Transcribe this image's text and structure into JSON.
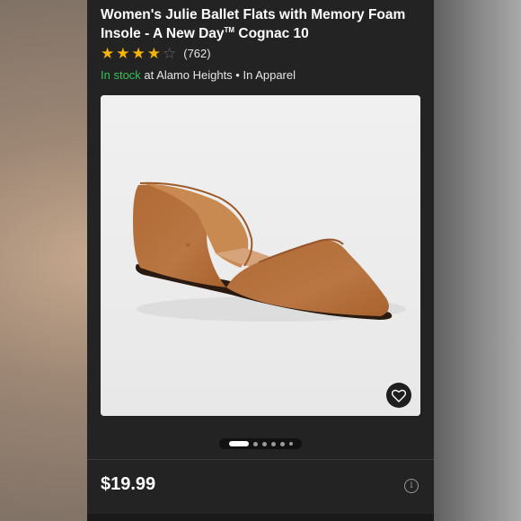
{
  "product": {
    "title": "Women's Julie Ballet Flats with Memory Foam Insole - A New Day",
    "trademark": "TM",
    "variant": " Cognac 10",
    "rating": 4,
    "rating_max": 5,
    "review_count": "(762)",
    "stock_status": "In stock",
    "stock_location": " at Alamo Heights • In Apparel",
    "price": "$19.99"
  },
  "image": {
    "carousel_count": 6,
    "active_index": 0,
    "favorite_icon": "heart-icon"
  },
  "colors": {
    "background": "#232323",
    "in_stock": "#32c15a",
    "star": "#f4b400",
    "shoe": "#b5713c"
  },
  "icons": {
    "info": "info-icon"
  },
  "labels": {
    "info_glyph": "i"
  }
}
